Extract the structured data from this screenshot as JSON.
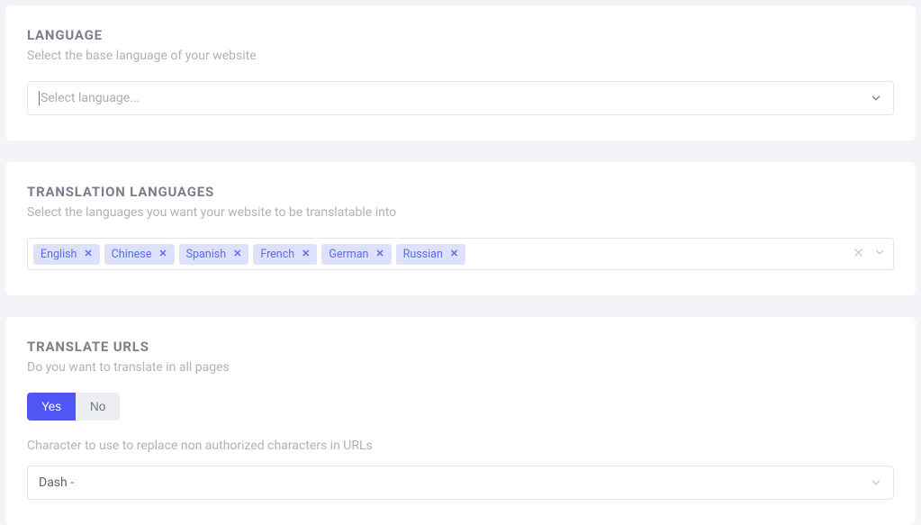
{
  "language": {
    "title": "LANGUAGE",
    "description": "Select the base language of your website",
    "placeholder": "Select language..."
  },
  "translation_languages": {
    "title": "TRANSLATION LANGUAGES",
    "description": "Select the languages you want your website to be translatable into",
    "tags": [
      "English",
      "Chinese",
      "Spanish",
      "French",
      "German",
      "Russian"
    ]
  },
  "translate_urls": {
    "title": "TRANSLATE URLS",
    "description": "Do you want to translate in all pages",
    "yes_label": "Yes",
    "no_label": "No",
    "replace_char_label": "Character to use to replace non authorized characters in URLs",
    "replace_char_value": "Dash -"
  },
  "icons": {
    "remove": "✕"
  }
}
